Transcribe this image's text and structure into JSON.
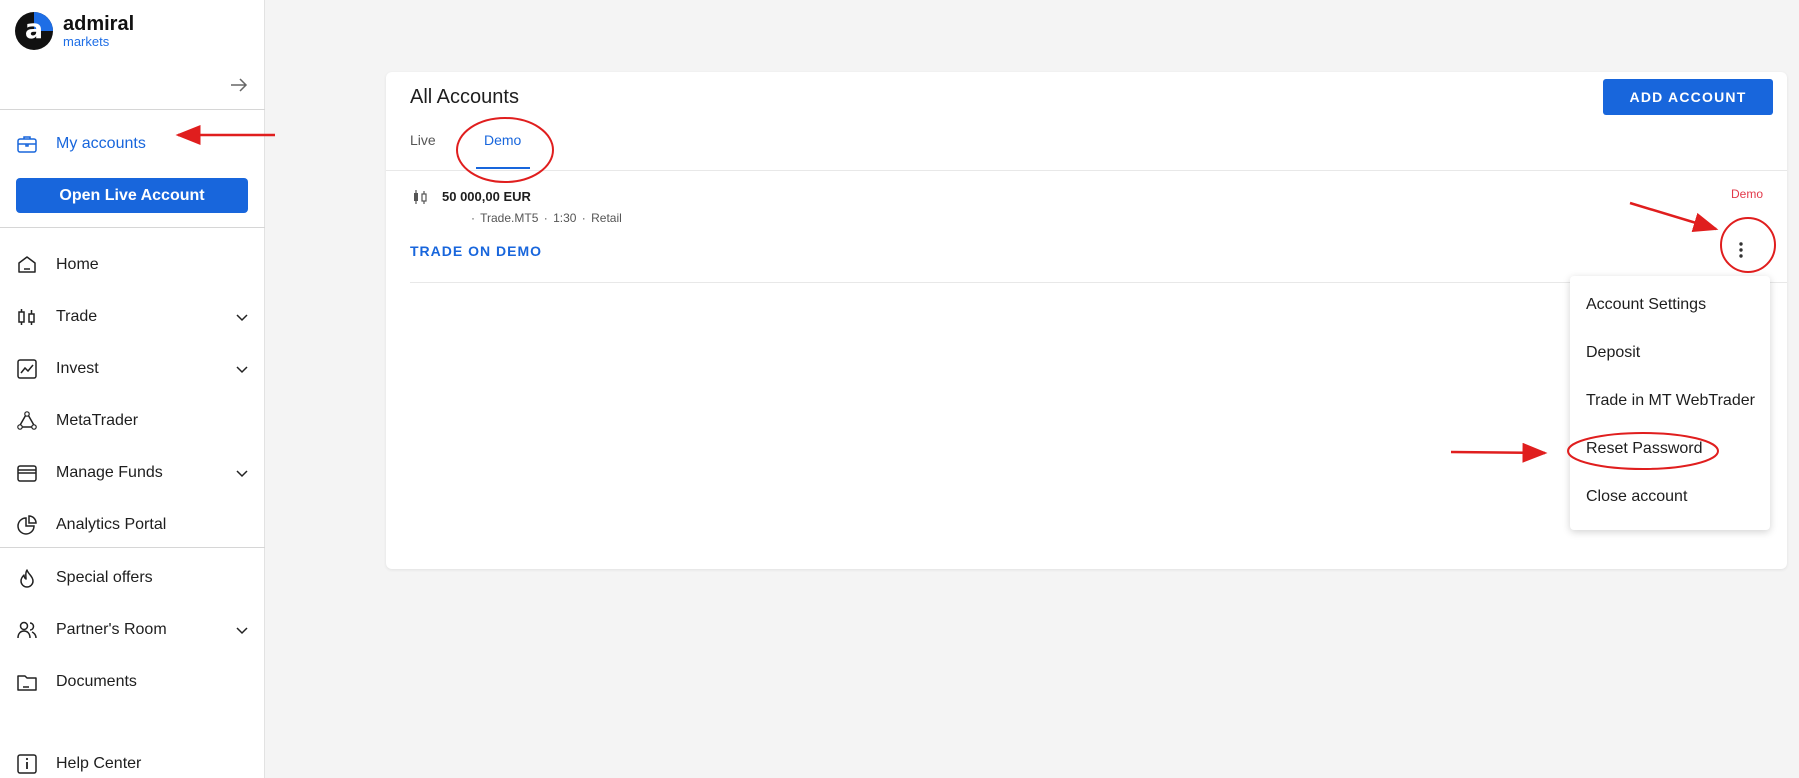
{
  "brand": {
    "name": "admiral",
    "sub": "markets",
    "letter": "a",
    "accent": "#1e6ee6"
  },
  "colors": {
    "primary": "#1866dc",
    "danger": "#e2394a",
    "annotation": "#e01e1e"
  },
  "sidebar": {
    "collapse_icon": "arrow-right-icon",
    "my_accounts": {
      "label": "My accounts",
      "icon": "briefcase-icon"
    },
    "open_live_label": "Open Live Account",
    "nav": [
      {
        "label": "Home",
        "icon": "home-icon"
      },
      {
        "label": "Trade",
        "icon": "candlestick-icon",
        "has_chevron": true
      },
      {
        "label": "Invest",
        "icon": "chart-line-icon",
        "has_chevron": true
      },
      {
        "label": "MetaTrader",
        "icon": "metatrader-icon"
      },
      {
        "label": "Manage Funds",
        "icon": "wallet-icon",
        "has_chevron": true
      },
      {
        "label": "Analytics Portal",
        "icon": "pie-chart-icon"
      },
      {
        "label": "Special offers",
        "icon": "flame-icon"
      },
      {
        "label": "Partner's Room",
        "icon": "users-icon",
        "has_chevron": true
      },
      {
        "label": "Documents",
        "icon": "folder-icon"
      },
      {
        "label": "Help Center",
        "icon": "info-icon"
      }
    ]
  },
  "main": {
    "title": "All Accounts",
    "add_account_label": "ADD ACCOUNT",
    "tabs": [
      {
        "label": "Live"
      },
      {
        "label": "Demo",
        "active": true
      }
    ],
    "account": {
      "balance": "50 000,00 EUR",
      "meta": [
        "Trade.MT5",
        "1:30",
        "Retail"
      ],
      "separator": "·",
      "badge": "Demo",
      "trade_link": "TRADE ON DEMO"
    },
    "menu": [
      "Account Settings",
      "Deposit",
      "Trade in MT WebTrader",
      "Reset Password",
      "Close account"
    ]
  }
}
